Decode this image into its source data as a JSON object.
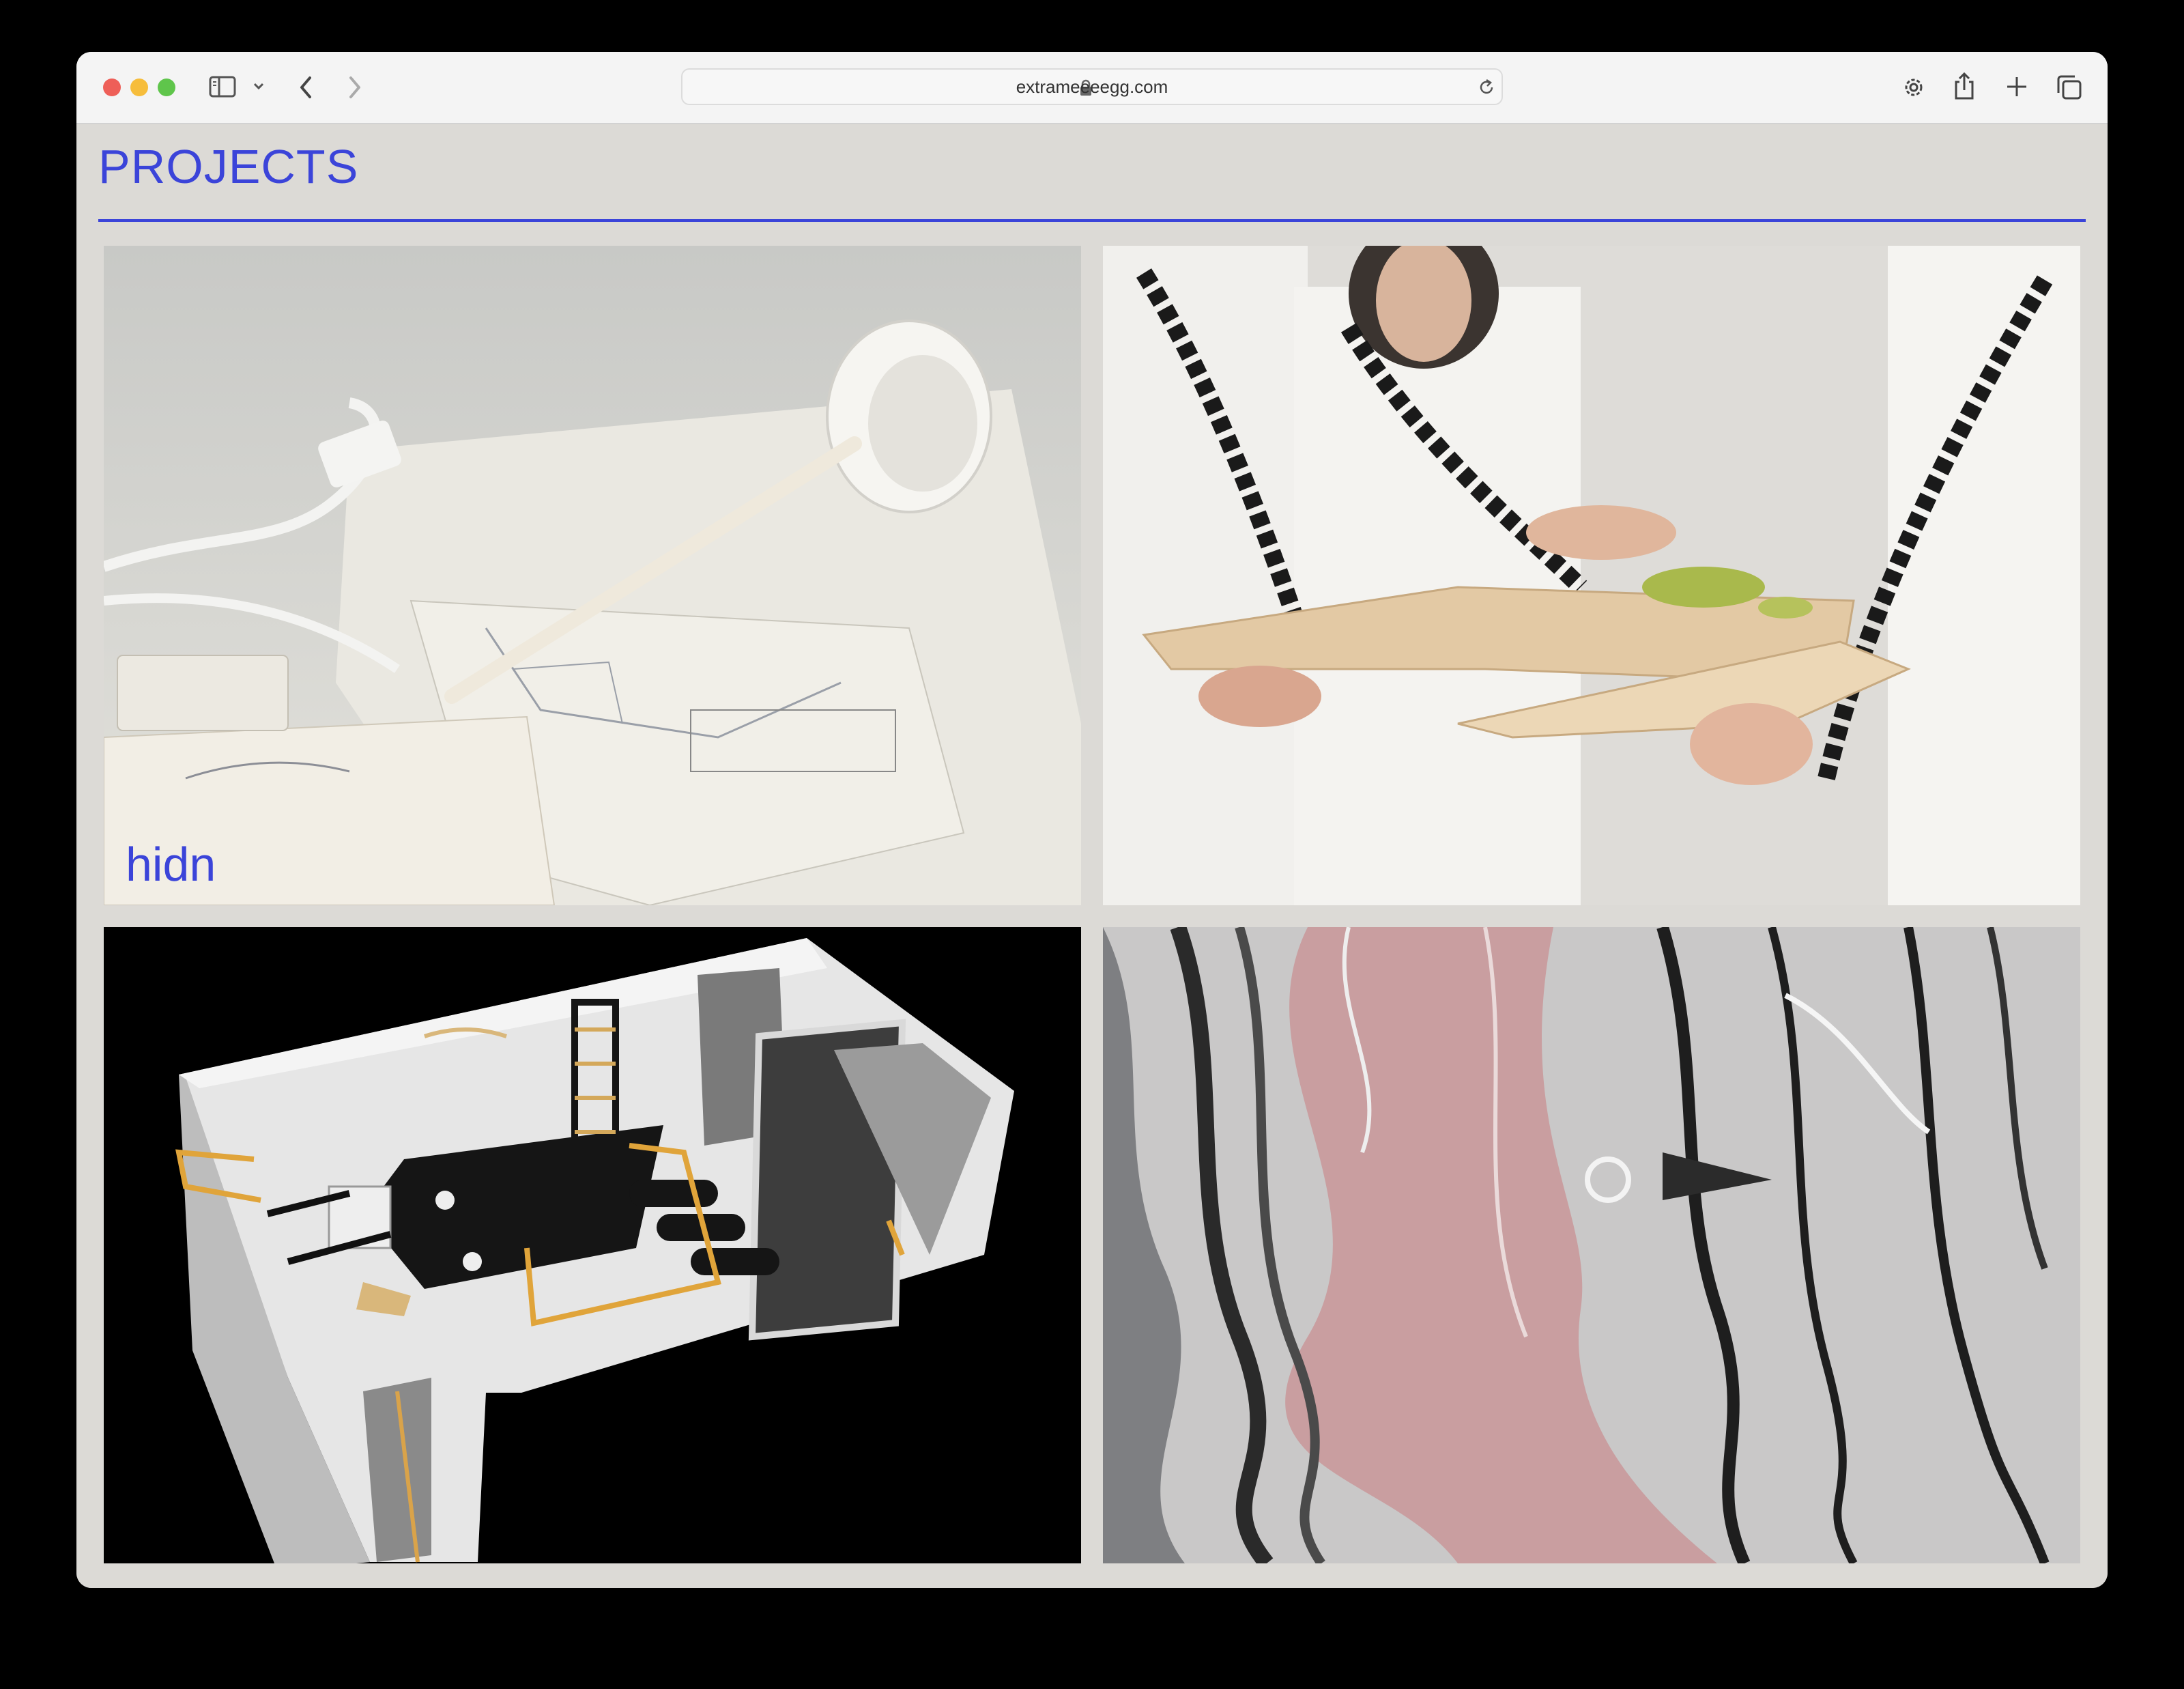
{
  "browser": {
    "url": "extrameeeegg.com",
    "icons": [
      "sidebar-icon",
      "chevron-down-icon",
      "back-icon",
      "forward-icon",
      "lock-icon",
      "reload-icon",
      "gear-icon",
      "share-icon",
      "plus-icon",
      "tabs-icon"
    ]
  },
  "page": {
    "title": "PROJECTS",
    "accent_color": "#3b44d9",
    "background_color": "#dcdad6",
    "projects": [
      {
        "label": "hidn"
      },
      {
        "label": ""
      },
      {
        "label": ""
      },
      {
        "label": ""
      }
    ]
  }
}
